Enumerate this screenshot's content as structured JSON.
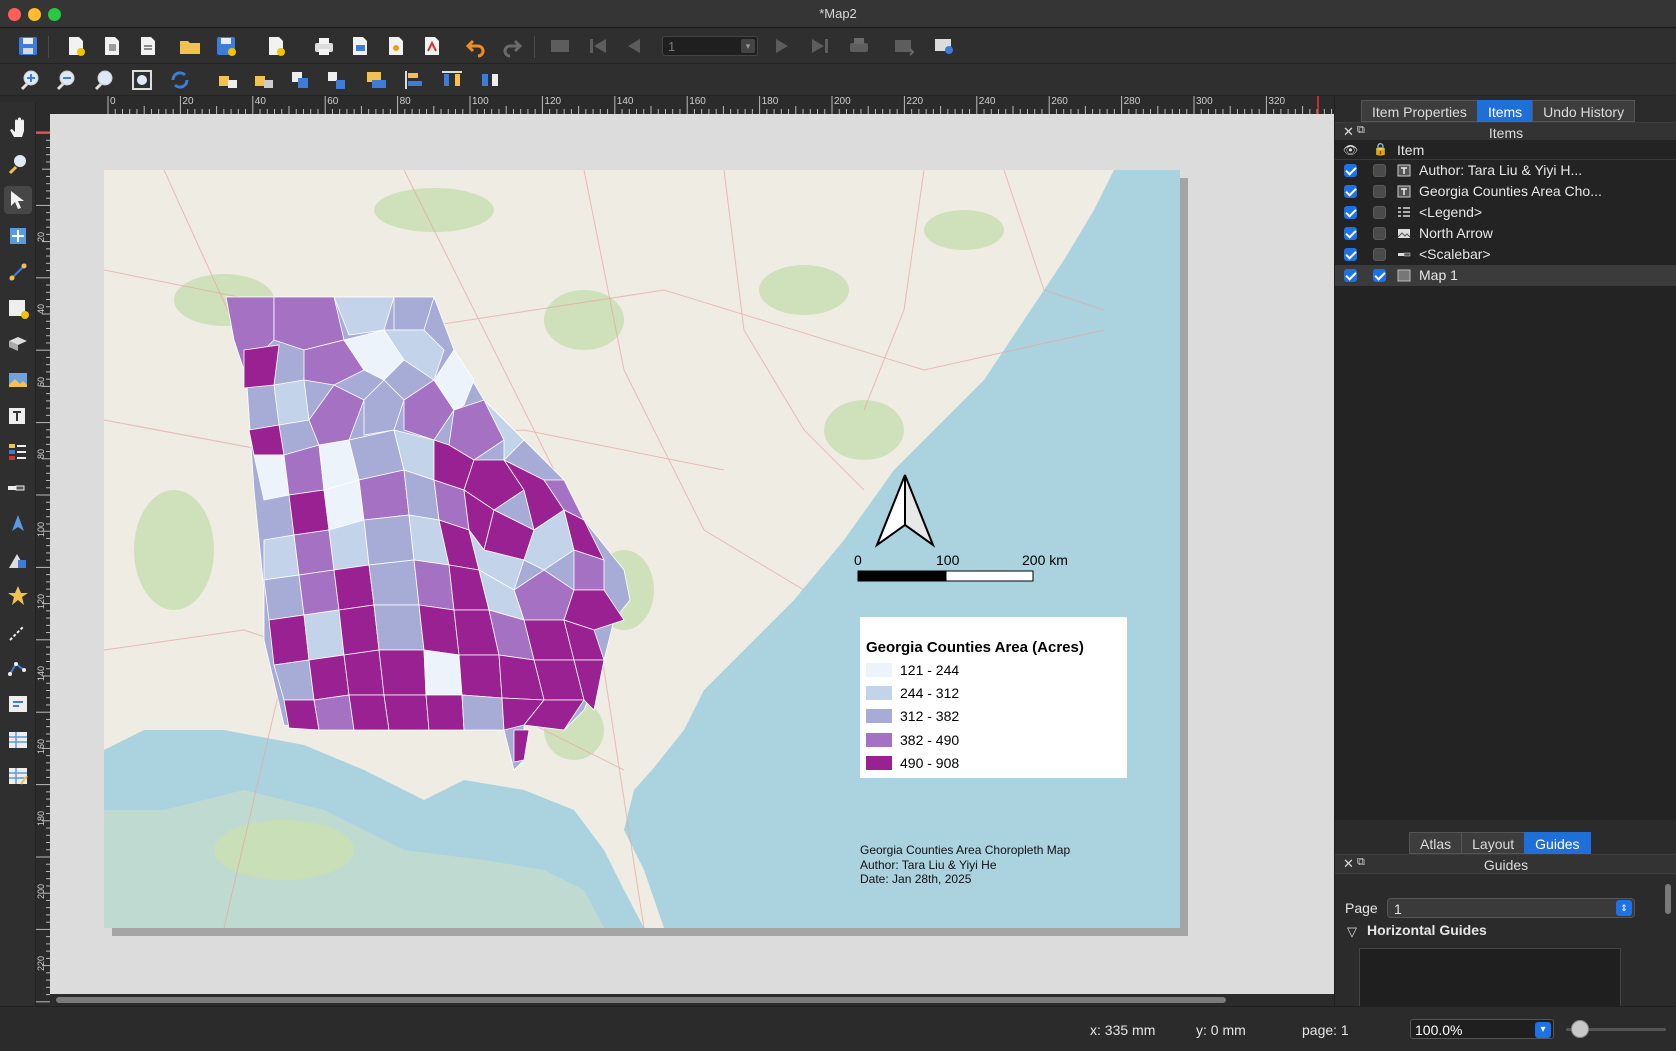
{
  "window": {
    "title": "*Map2"
  },
  "colors": {
    "close": "#fe5f57",
    "minimize": "#febc2e",
    "maximize": "#28c840",
    "accent": "#1f6fd9"
  },
  "toolbar": {
    "page_field": "1",
    "icons": [
      "save-layout-icon",
      "new-layout-icon",
      "duplicate-layout-icon",
      "layout-manager-icon",
      "open-template-icon",
      "save-template-icon",
      "page-add-icon",
      "print-icon",
      "export-image-icon",
      "export-svg-icon",
      "export-pdf-icon",
      "undo-icon",
      "redo-icon",
      "atlas-preview-icon",
      "first-feature-icon",
      "previous-feature-icon",
      "next-feature-icon",
      "last-feature-icon",
      "atlas-print-icon",
      "atlas-export-icon",
      "atlas-settings-icon"
    ]
  },
  "toolbar2": {
    "icons": [
      "zoom-in-icon",
      "zoom-out-icon",
      "zoom-actual-icon",
      "zoom-full-icon",
      "refresh-icon",
      "lock-items-icon",
      "unlock-items-icon",
      "group-icon",
      "ungroup-icon",
      "raise-icon",
      "align-icon",
      "distribute-icon",
      "resize-icon"
    ]
  },
  "leftbar": {
    "icons": [
      "pan-icon",
      "zoom-tool-icon",
      "select-icon",
      "move-content-icon",
      "edit-nodes-icon",
      "add-map-icon",
      "add-3d-map-icon",
      "add-picture-icon",
      "add-label-icon",
      "add-legend-icon",
      "add-scalebar-icon",
      "add-north-arrow-icon",
      "add-shape-icon",
      "add-marker-icon",
      "add-arrow-icon",
      "add-nodes-icon",
      "add-html-icon",
      "add-attribute-table-icon",
      "add-fixed-table-icon"
    ]
  },
  "rulers": {
    "top": [
      "0",
      "20",
      "40",
      "60",
      "80",
      "100",
      "120",
      "140",
      "160",
      "180",
      "200",
      "220",
      "240",
      "260",
      "280",
      "300",
      "320"
    ],
    "left": [
      "20",
      "40",
      "60",
      "80",
      "100",
      "120",
      "140",
      "160",
      "180",
      "200",
      "220"
    ]
  },
  "layout": {
    "scalebar": {
      "labels": [
        "0",
        "100",
        "200 km"
      ]
    },
    "legend": {
      "title": "Georgia Counties Area (Acres)",
      "items": [
        {
          "label": "121 - 244",
          "color": "#edf3fa"
        },
        {
          "label": "244 - 312",
          "color": "#c3d3ea"
        },
        {
          "label": "312 - 382",
          "color": "#a7acd6"
        },
        {
          "label": "382 - 490",
          "color": "#a571c2"
        },
        {
          "label": "490 - 908",
          "color": "#9a2191"
        }
      ]
    },
    "credits": {
      "line1": "Georgia Counties Area Choropleth Map",
      "line2": "Author: Tara Liu & Yiyi He",
      "line3": "Date: Jan 28th, 2025"
    }
  },
  "right_panel": {
    "top_tabs": [
      {
        "label": "Item Properties",
        "active": false
      },
      {
        "label": "Items",
        "active": true
      },
      {
        "label": "Undo History",
        "active": false
      }
    ],
    "items_title": "Items",
    "items_header": "Item",
    "items": [
      {
        "label": "Author: Tara Liu & Yiyi H...",
        "visible": true,
        "locked": false,
        "icon": "label-icon"
      },
      {
        "label": "Georgia Counties Area Cho...",
        "visible": true,
        "locked": false,
        "icon": "label-icon"
      },
      {
        "label": "<Legend>",
        "visible": true,
        "locked": false,
        "icon": "legend-icon"
      },
      {
        "label": "North Arrow",
        "visible": true,
        "locked": false,
        "icon": "picture-icon"
      },
      {
        "label": "<Scalebar>",
        "visible": true,
        "locked": false,
        "icon": "scalebar-icon"
      },
      {
        "label": "Map 1",
        "visible": true,
        "locked": true,
        "icon": "map-icon"
      }
    ],
    "bottom_tabs": [
      {
        "label": "Atlas",
        "active": false
      },
      {
        "label": "Layout",
        "active": false
      },
      {
        "label": "Guides",
        "active": true
      }
    ],
    "guides_title": "Guides",
    "page_label": "Page",
    "page_value": "1",
    "horizontal_guides": "Horizontal Guides"
  },
  "status": {
    "x": "x: 335 mm",
    "y": "y: 0 mm",
    "page": "page: 1",
    "zoom": "100.0%"
  }
}
